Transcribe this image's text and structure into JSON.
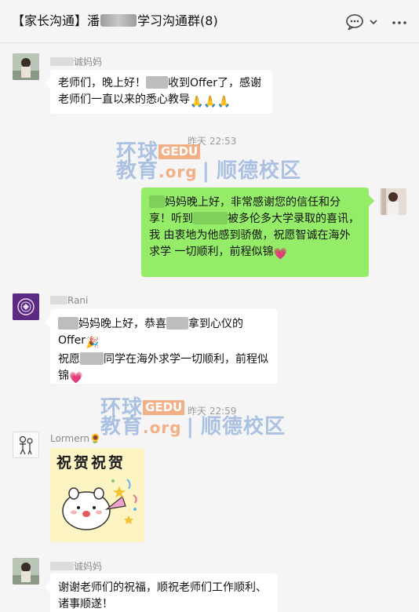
{
  "header": {
    "title_prefix": "【家长沟通】潘",
    "title_suffix": "学习沟通群(8)",
    "icons": [
      "chat-bubble-icon",
      "chevron-down-icon",
      "more-icon"
    ]
  },
  "messages": [
    {
      "sender": "诚妈妈",
      "lines": [
        "老师们，晚上好！",
        "收到Offer了，感谢",
        "老师们一直以来的悉心教导"
      ],
      "emoji": "🙏🙏🙏"
    },
    {
      "timestamp": "昨天 22:53"
    },
    {
      "sender": "me",
      "text_parts": [
        "妈妈晚上好，非常感谢您的信任和分",
        "享！听到",
        "被多伦多大学录取的喜讯，我",
        "由衷地为他感到骄傲，祝愿智诚在海外求学",
        "一切顺利，前程似锦"
      ],
      "emoji": "💗"
    },
    {
      "sender": "Rani",
      "text_parts": [
        "妈妈晚上好，恭喜",
        "拿到心仪的",
        "Offer",
        "祝愿",
        "同学在海外求学一切顺利，前程似",
        "锦"
      ],
      "emoji": [
        "🎉",
        "💗"
      ]
    },
    {
      "timestamp": "昨天 22:59"
    },
    {
      "sender": "Lormern🌻",
      "sticker_text": "祝贺祝贺"
    },
    {
      "sender": "诚妈妈",
      "lines": [
        "谢谢老师们的祝福，顺祝老师们工作顺利、",
        "诸事顺遂！"
      ]
    }
  ],
  "watermark": {
    "line1": "环球",
    "line2": "教育",
    "gedu": "GEDU",
    "org": ".org",
    "school": "顺德校区"
  },
  "colors": {
    "outgoing_bubble": "#95ec69",
    "incoming_bubble": "#ffffff",
    "background": "#f5f5f5"
  }
}
